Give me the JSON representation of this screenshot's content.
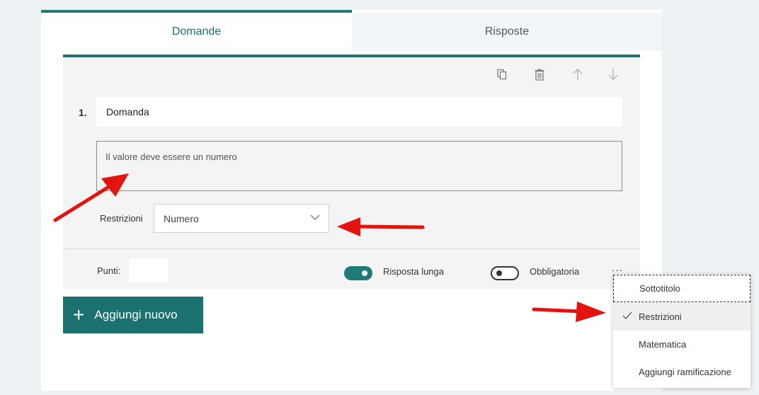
{
  "tabs": [
    {
      "label": "Domande",
      "active": true
    },
    {
      "label": "Risposte",
      "active": false
    }
  ],
  "question": {
    "number": "1.",
    "title": "Domanda",
    "subtitle": "Il valore deve essere un numero",
    "restrictions_label": "Restrizioni",
    "restrictions_value": "Numero",
    "points_label": "Punti:",
    "points_value": "",
    "long_answer_label": "Risposta lunga",
    "long_answer_on": true,
    "required_label": "Obbligatoria",
    "required_on": false,
    "more_options": "..."
  },
  "add_button_label": "Aggiungi nuovo",
  "menu": {
    "items": [
      {
        "label": "Sottotitolo",
        "checked": false,
        "focused": true
      },
      {
        "label": "Restrizioni",
        "checked": true,
        "focused": false
      },
      {
        "label": "Matematica",
        "checked": false,
        "focused": false
      },
      {
        "label": "Aggiungi ramificazione",
        "checked": false,
        "focused": false
      }
    ]
  },
  "colors": {
    "accent": "#1f7473",
    "annotation_arrow": "#e3130f"
  },
  "icons": [
    "copy-icon",
    "trash-icon",
    "arrow-up-icon",
    "arrow-down-icon",
    "chevron-down-icon",
    "plus-icon",
    "check-icon"
  ]
}
